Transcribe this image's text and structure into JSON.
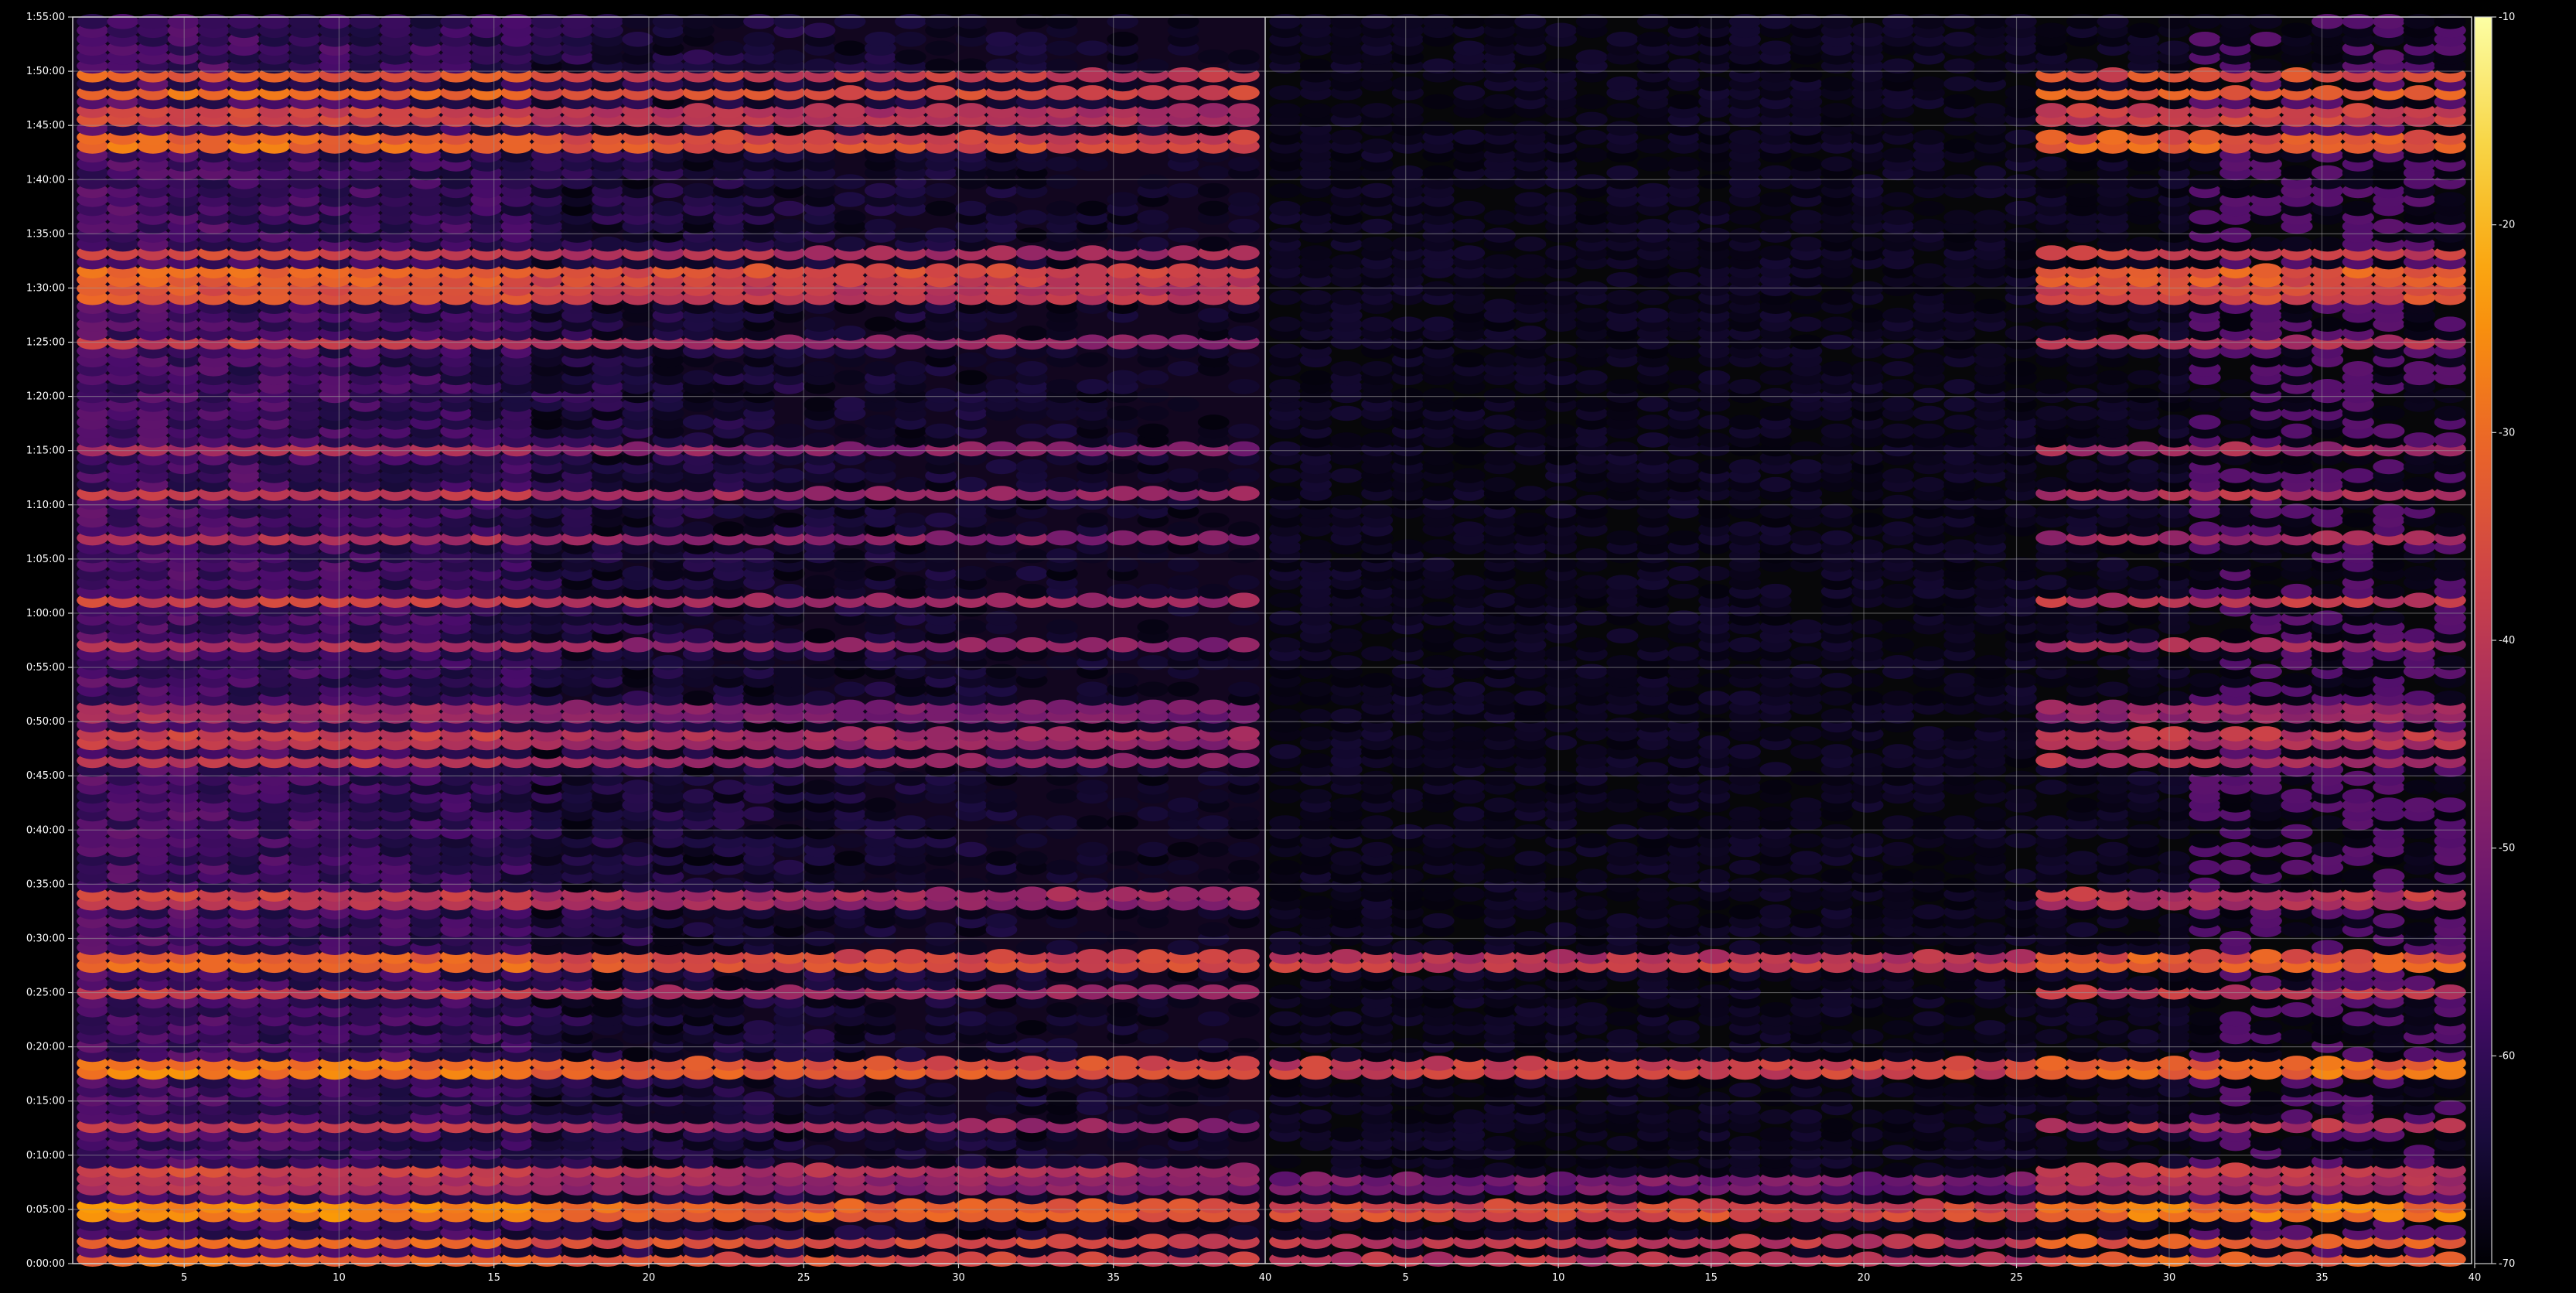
{
  "chart_data": {
    "type": "heatmap",
    "background": "#000000",
    "axis_color": "#cfcfcf",
    "grid": true,
    "colormap": "inferno",
    "colormap_stops": [
      "#000004",
      "#1b0c41",
      "#4a0c6b",
      "#781c6d",
      "#a52c60",
      "#cf4446",
      "#ed6925",
      "#fb9b06",
      "#f7d13d",
      "#fcffa4"
    ],
    "colorbar": {
      "min": -70,
      "max": -10,
      "ticks": [
        "-10",
        "-20",
        "-30",
        "-40",
        "-50",
        "-60",
        "-70"
      ],
      "placement": "right"
    },
    "panels": [
      {
        "name": "",
        "x_range": [
          1.4,
          39.9
        ],
        "x_ticks": [
          "5",
          "10",
          "15",
          "20",
          "25",
          "30",
          "35"
        ],
        "x_tick_values": [
          5,
          10,
          15,
          20,
          25,
          30,
          35
        ],
        "columns": 39,
        "rows": 140,
        "base_level": -60,
        "edge_label": "40"
      },
      {
        "name": "",
        "x_range": [
          0.4,
          39.9
        ],
        "x_ticks": [
          "5",
          "10",
          "15",
          "20",
          "25",
          "30",
          "35",
          "40"
        ],
        "x_tick_values": [
          5,
          10,
          15,
          20,
          25,
          30,
          35,
          40
        ],
        "columns": 39,
        "rows": 140,
        "base_level": -70,
        "right_cols_start": 25
      }
    ],
    "y_range_minutes": [
      0,
      115
    ],
    "y_ticks": [
      "0:00:00",
      "0:05:00",
      "0:10:00",
      "0:15:00",
      "0:20:00",
      "0:25:00",
      "0:30:00",
      "0:35:00",
      "0:40:00",
      "0:45:00",
      "0:50:00",
      "0:55:00",
      "1:00:00",
      "1:05:00",
      "1:10:00",
      "1:15:00",
      "1:20:00",
      "1:25:00",
      "1:30:00",
      "1:35:00",
      "1:40:00",
      "1:45:00",
      "1:50:00",
      "1:55:00"
    ],
    "y_tick_minutes": [
      0,
      5,
      10,
      15,
      20,
      25,
      30,
      35,
      40,
      45,
      50,
      55,
      60,
      65,
      70,
      75,
      80,
      85,
      90,
      95,
      100,
      105,
      110,
      115
    ],
    "bands": [
      {
        "minute": 0.6,
        "level": -31
      },
      {
        "minute": 2.0,
        "level": -32
      },
      {
        "minute": 4.9,
        "level": -25
      },
      {
        "minute": 7.5,
        "level": -40
      },
      {
        "minute": 8.5,
        "level": -38
      },
      {
        "minute": 12.5,
        "level": -40
      },
      {
        "minute": 18.0,
        "level": -27
      },
      {
        "minute": 24.8,
        "level": -38
      },
      {
        "minute": 27.8,
        "level": -29
      },
      {
        "minute": 33.8,
        "level": -38
      },
      {
        "minute": 46.3,
        "level": -41
      },
      {
        "minute": 48.6,
        "level": -38
      },
      {
        "minute": 50.9,
        "level": -43
      },
      {
        "minute": 57.0,
        "level": -43
      },
      {
        "minute": 61.3,
        "level": -39
      },
      {
        "minute": 66.7,
        "level": -42
      },
      {
        "minute": 71.1,
        "level": -41
      },
      {
        "minute": 75.0,
        "level": -43
      },
      {
        "minute": 85.2,
        "level": -40
      },
      {
        "minute": 89.5,
        "level": -33
      },
      {
        "minute": 91.3,
        "level": -30
      },
      {
        "minute": 93.1,
        "level": -38
      },
      {
        "minute": 103.4,
        "level": -29
      },
      {
        "minute": 105.9,
        "level": -35
      },
      {
        "minute": 108.0,
        "level": -32
      },
      {
        "minute": 109.4,
        "level": -33
      }
    ]
  }
}
